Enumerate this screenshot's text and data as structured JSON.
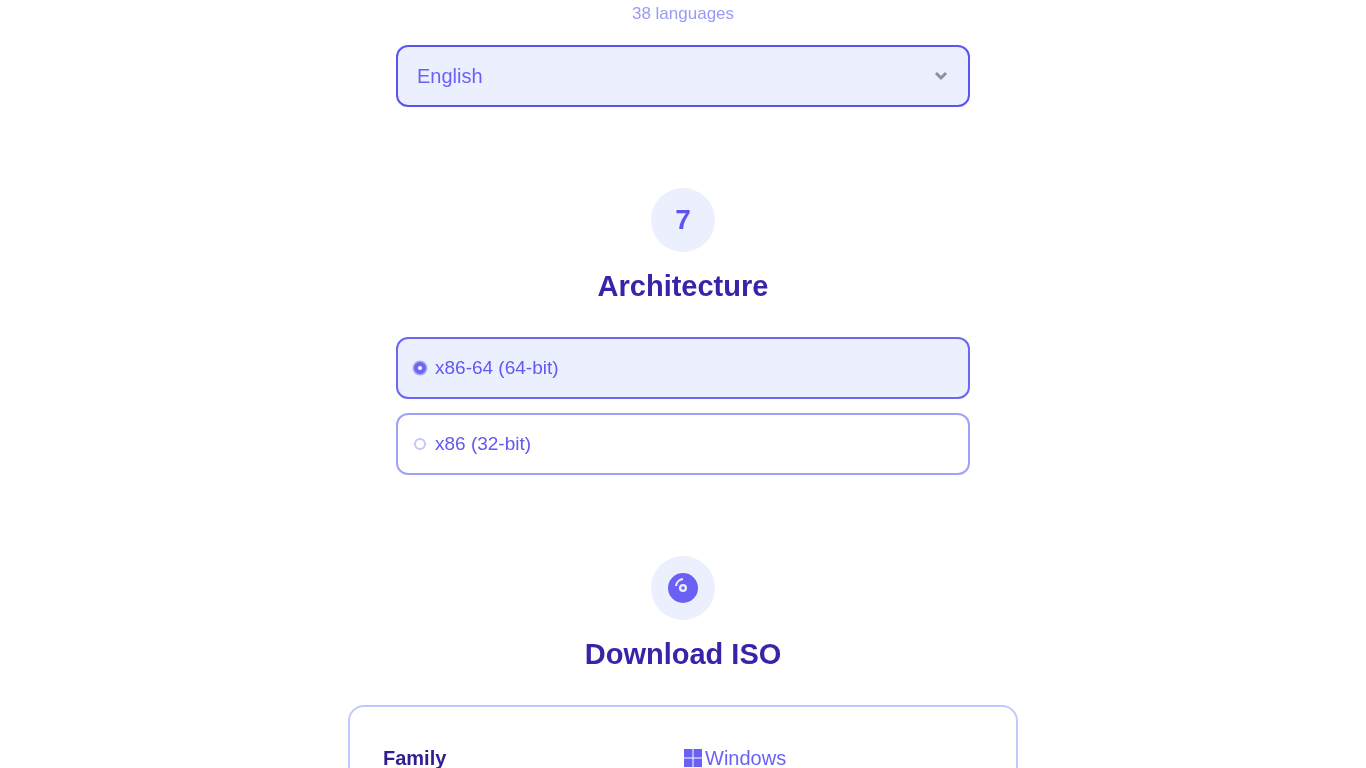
{
  "language_count": "38 languages",
  "language_select": {
    "value": "English"
  },
  "steps": [
    {
      "kind": "number",
      "badge": "7",
      "title": "Architecture",
      "options": [
        {
          "label": "x86-64 (64-bit)",
          "selected": true
        },
        {
          "label": "x86 (32-bit)",
          "selected": false
        }
      ]
    },
    {
      "kind": "disc",
      "title": "Download ISO"
    }
  ],
  "download_card": {
    "rows": [
      {
        "label": "Family",
        "value": "Windows"
      }
    ]
  }
}
